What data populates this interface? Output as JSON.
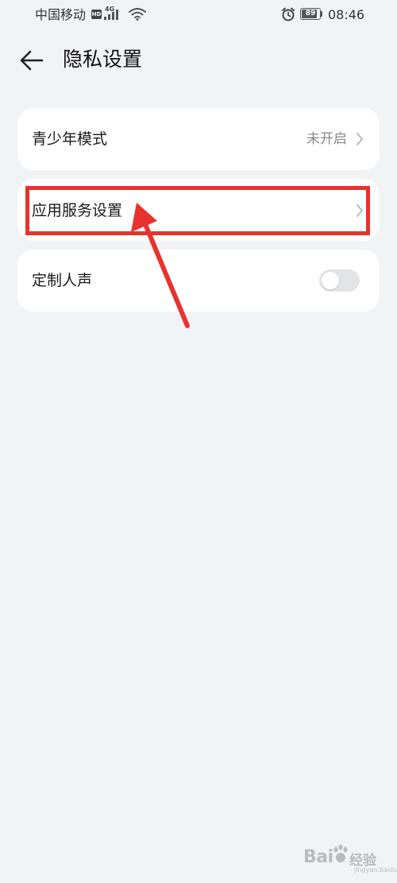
{
  "status_bar": {
    "carrier": "中国移动",
    "hd_badge": "HD",
    "network_type": "4G",
    "battery_level": 89,
    "time": "08:46",
    "icons": [
      "hd-icon",
      "signal-icon",
      "wifi-icon",
      "alarm-icon",
      "battery-icon"
    ]
  },
  "header": {
    "back_icon": "back-arrow-icon",
    "title": "隐私设置"
  },
  "settings": {
    "youth_mode": {
      "label": "青少年模式",
      "value": "未开启",
      "icon": "chevron-right-icon"
    },
    "app_service": {
      "label": "应用服务设置",
      "icon": "chevron-right-icon"
    },
    "custom_voice": {
      "label": "定制人声",
      "toggle_on": false
    }
  },
  "annotation": {
    "highlight_color": "#e8322d",
    "arrow_color": "#e8322d"
  },
  "watermark": {
    "brand": "Bai",
    "brand_suffix": "经验",
    "url": "jingyan.baidu.com"
  },
  "colors": {
    "background": "#f2f3f5",
    "card": "#ffffff",
    "toggle_off": "#e3e4e6",
    "secondary_text": "#888888"
  }
}
